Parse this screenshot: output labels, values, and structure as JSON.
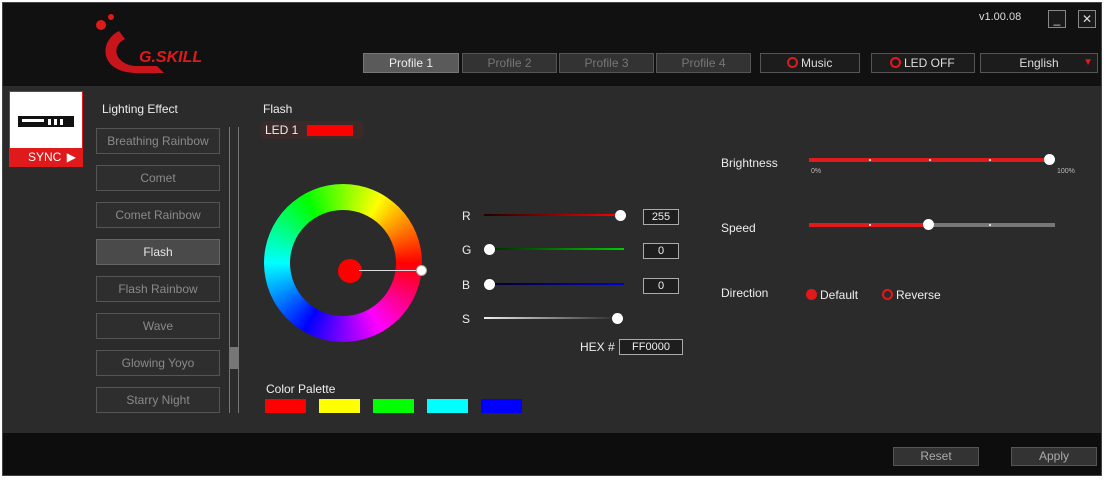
{
  "header": {
    "brand": "G.SKILL",
    "version": "v1.00.08",
    "minimize": "_",
    "close": "✕",
    "profiles": [
      "Profile 1",
      "Profile 2",
      "Profile 3",
      "Profile 4"
    ],
    "active_profile": "Profile 1",
    "music_label": "Music",
    "led_off_label": "LED OFF",
    "language": "English"
  },
  "sidebar": {
    "sync_label": "SYNC"
  },
  "effects": {
    "heading": "Lighting Effect",
    "items": [
      "Breathing Rainbow",
      "Comet",
      "Comet Rainbow",
      "Flash",
      "Flash Rainbow",
      "Wave",
      "Glowing Yoyo",
      "Starry Night"
    ],
    "selected": "Flash"
  },
  "editor": {
    "heading": "Flash",
    "led_label": "LED 1",
    "led_color": "#ff0000",
    "r_label": "R",
    "r_value": "255",
    "g_label": "G",
    "g_value": "0",
    "b_label": "B",
    "b_value": "0",
    "s_label": "S",
    "hex_label": "HEX #",
    "hex_value": "FF0000",
    "palette_label": "Color Palette",
    "palette": [
      "#ff0000",
      "#ffff00",
      "#00ff00",
      "#00ffff",
      "#0000ff"
    ]
  },
  "settings": {
    "brightness_label": "Brightness",
    "brightness_level": 1.0,
    "brightness_min": "0%",
    "brightness_max": "100%",
    "speed_label": "Speed",
    "speed_level": 0.5,
    "direction_label": "Direction",
    "direction_default": "Default",
    "direction_reverse": "Reverse",
    "direction_selected": "Default"
  },
  "footer": {
    "reset_label": "Reset",
    "apply_label": "Apply"
  },
  "colors": {
    "accent": "#e01a1a"
  }
}
